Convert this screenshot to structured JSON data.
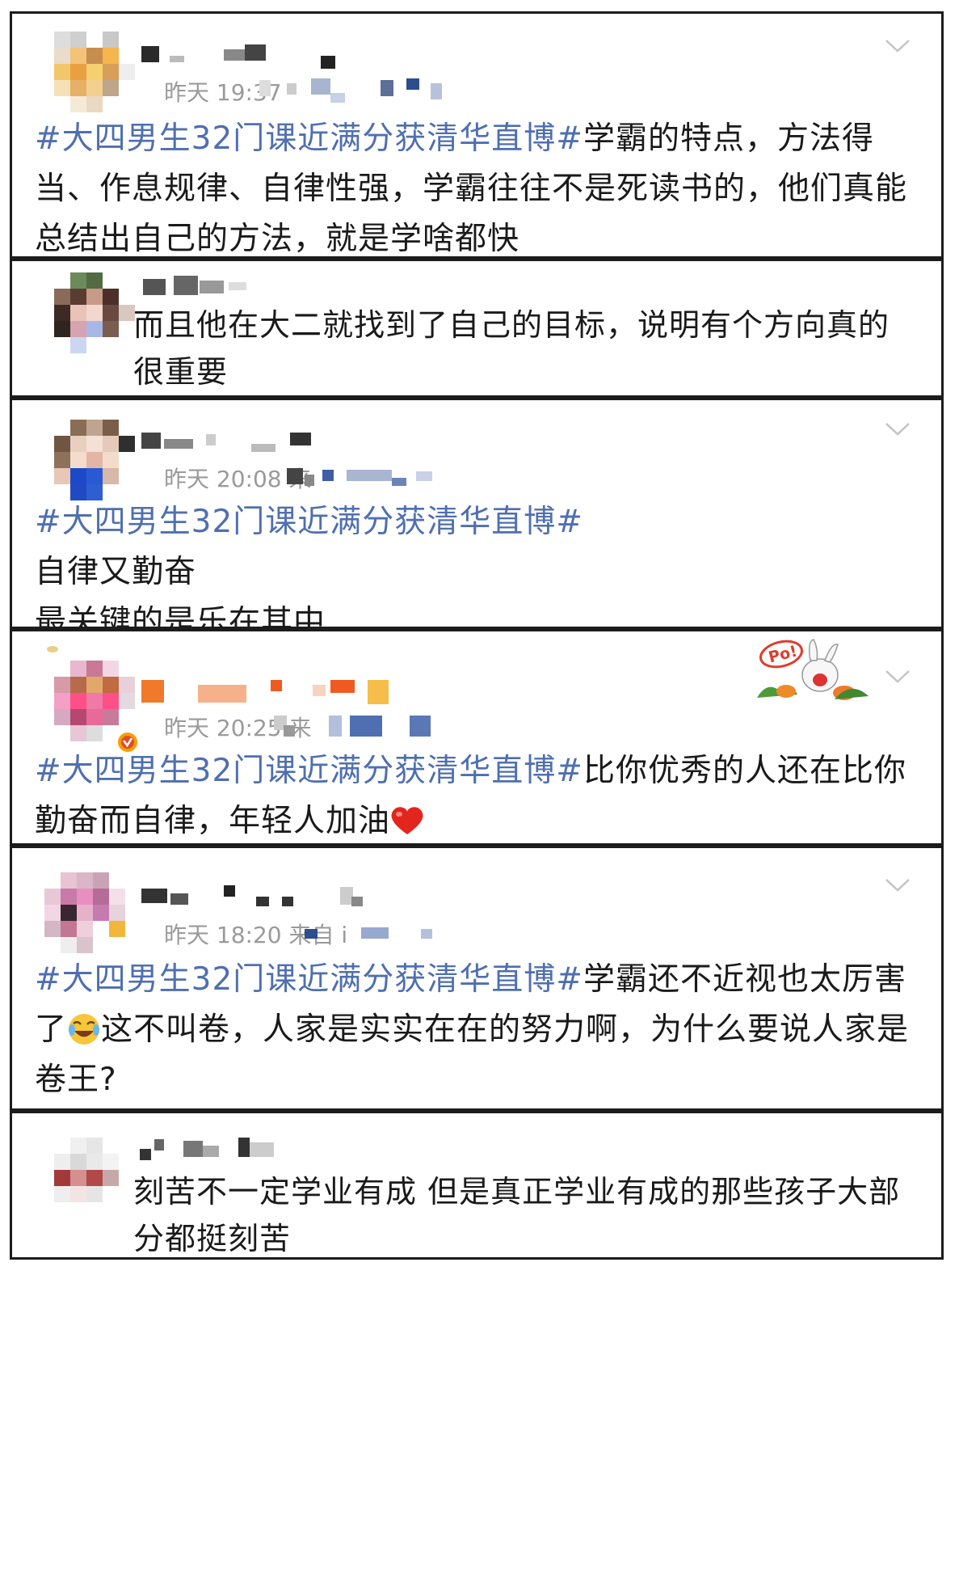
{
  "comments": [
    {
      "time": "昨天 19:37",
      "hashtag": "#大四男生32门课近满分获清华直博#",
      "body": "学霸的特点，方法得当、作息规律、自律性强，学霸往往不是死读书的，他们真能总结出自己的方法，就是学啥都快"
    },
    {
      "time": "",
      "hashtag": "",
      "body": "而且他在大二就找到了自己的目标，说明有个方向真的很重要"
    },
    {
      "time": "昨天 20:08  来",
      "hashtag": "#大四男生32门课近满分获清华直博#",
      "body": "\n自律又勤奋\n最关键的是乐在其中"
    },
    {
      "time": "昨天 20:25  来",
      "hashtag": "#大四男生32门课近满分获清华直博#",
      "body": "比你优秀的人还在比你勤奋而自律，年轻人加油",
      "sticker_text": "Po!"
    },
    {
      "time": "昨天 18:20  来自 i",
      "hashtag": "#大四男生32门课近满分获清华直博#",
      "body_a": "学霸还不近视也太厉害了",
      "body_b": "这不叫卷，人家是实实在在的努力啊，为什么要说人家是卷王?"
    },
    {
      "time": "",
      "hashtag": "",
      "body": "刻苦不一定学业有成 但是真正学业有成的那些孩子大部分都挺刻苦"
    }
  ],
  "colors": {
    "hashtag": "#4f6fb0",
    "time": "#9a9a9a",
    "border": "#1c1c1c"
  }
}
